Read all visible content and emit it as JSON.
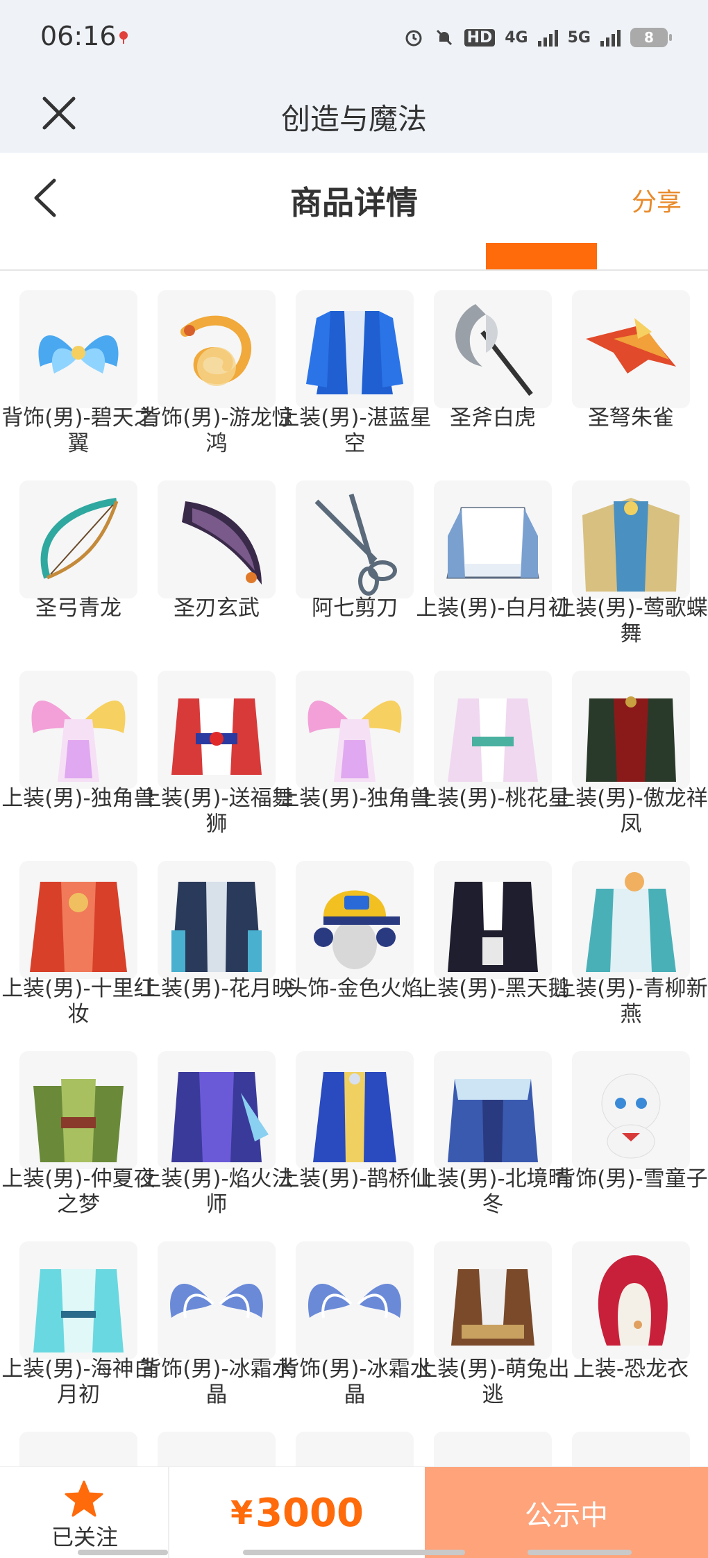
{
  "status_bar": {
    "time": "06:16",
    "hd_label": "HD",
    "net1": "4G",
    "net2": "5G",
    "battery": "8"
  },
  "app_bar": {
    "title": "创造与魔法"
  },
  "header": {
    "title": "商品详情",
    "share": "分享"
  },
  "items": [
    {
      "name": "背饰(男)-碧天之翼",
      "icon": "blue-wings-icon"
    },
    {
      "name": "背饰(男)-游龙惊鸿",
      "icon": "golden-dragon-icon"
    },
    {
      "name": "上装(男)-湛蓝星空",
      "icon": "blue-outfit-icon"
    },
    {
      "name": "圣斧白虎",
      "icon": "axe-icon"
    },
    {
      "name": "圣弩朱雀",
      "icon": "phoenix-crossbow-icon"
    },
    {
      "name": "圣弓青龙",
      "icon": "dragon-bow-icon"
    },
    {
      "name": "圣刃玄武",
      "icon": "blade-icon"
    },
    {
      "name": "阿七剪刀",
      "icon": "scissors-icon"
    },
    {
      "name": "上装(男)-白月初",
      "icon": "white-outfit-icon"
    },
    {
      "name": "上装(男)-莺歌蝶舞",
      "icon": "feather-outfit-icon"
    },
    {
      "name": "上装(男)-独角兽",
      "icon": "rainbow-wings-icon"
    },
    {
      "name": "上装(男)-送福舞狮",
      "icon": "lion-outfit-icon"
    },
    {
      "name": "上装(男)-独角兽",
      "icon": "rainbow-wings-icon"
    },
    {
      "name": "上装(男)-桃花星",
      "icon": "peach-outfit-icon"
    },
    {
      "name": "上装(男)-傲龙祥凤",
      "icon": "dark-red-outfit-icon"
    },
    {
      "name": "上装(男)-十里红妆",
      "icon": "red-robe-icon"
    },
    {
      "name": "上装(男)-花月映",
      "icon": "navy-coat-icon"
    },
    {
      "name": "头饰-金色火焰",
      "icon": "yellow-cap-icon"
    },
    {
      "name": "上装(男)-黑天鹅",
      "icon": "black-coat-icon"
    },
    {
      "name": "上装(男)-青柳新燕",
      "icon": "teal-robe-icon"
    },
    {
      "name": "上装(男)-仲夏夜之梦",
      "icon": "green-armor-icon"
    },
    {
      "name": "上装(男)-焰火法师",
      "icon": "purple-mage-icon"
    },
    {
      "name": "上装(男)-鹊桥仙",
      "icon": "royal-blue-robe-icon"
    },
    {
      "name": "上装(男)-北境晴冬",
      "icon": "winter-outfit-icon"
    },
    {
      "name": "背饰(男)-雪童子",
      "icon": "snow-doll-icon"
    },
    {
      "name": "上装(男)-海神白月初",
      "icon": "aqua-robe-icon"
    },
    {
      "name": "背饰(男)-冰霜水晶",
      "icon": "ice-wings-icon"
    },
    {
      "name": "背饰(男)-冰霜水晶",
      "icon": "ice-wings-icon"
    },
    {
      "name": "上装(男)-萌兔出逃",
      "icon": "brown-outfit-icon"
    },
    {
      "name": "上装-恐龙衣",
      "icon": "dino-costume-icon"
    }
  ],
  "bottom_bar": {
    "follow_label": "已关注",
    "price_symbol": "¥",
    "price": "3000",
    "status": "公示中"
  },
  "colors": {
    "accent": "#ff6a0a",
    "share": "#e98a2a",
    "status_btn": "#ffa37a",
    "topbar_bg": "#eff3f8"
  }
}
